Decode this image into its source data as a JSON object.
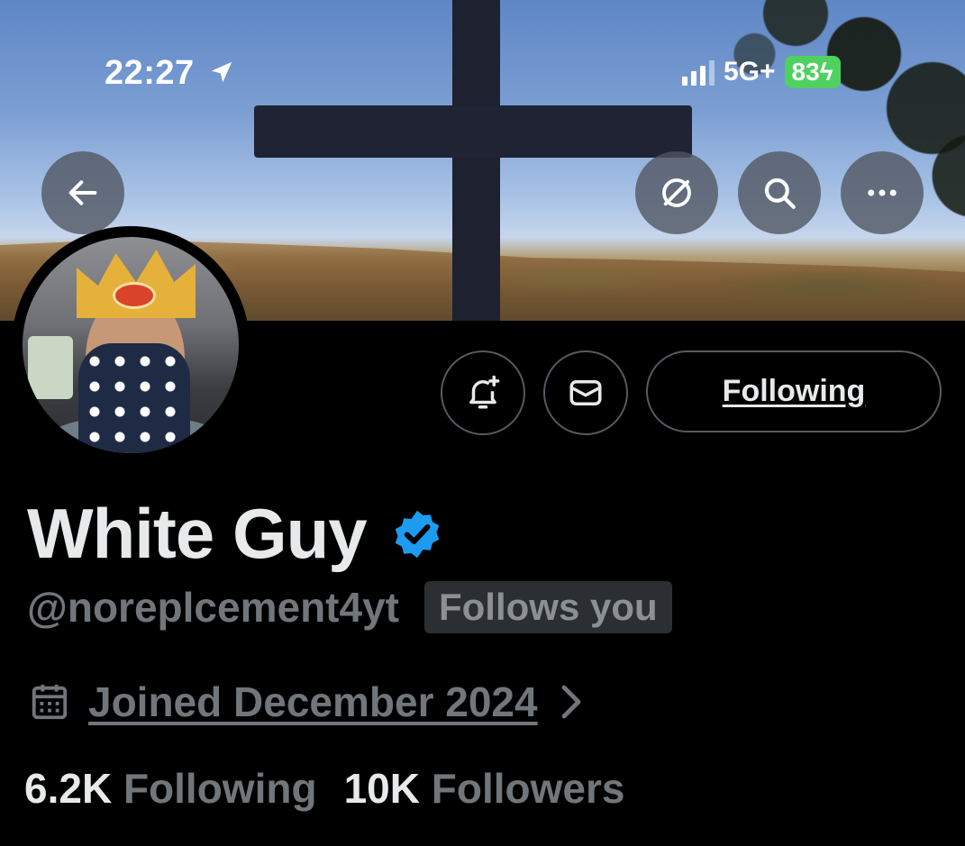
{
  "status_bar": {
    "time": "22:27",
    "network": "5G+",
    "battery": "83"
  },
  "banner_buttons": {
    "back_icon": "arrow-left-icon",
    "grok_icon": "slash-circle-icon",
    "search_icon": "search-icon",
    "more_icon": "more-horizontal-icon"
  },
  "actions": {
    "notify_icon": "bell-plus-icon",
    "message_icon": "envelope-icon",
    "follow_label": "Following"
  },
  "profile": {
    "display_name": "White Guy",
    "handle": "@noreplcement4yt",
    "follows_you": "Follows you",
    "joined": "Joined December 2024",
    "verified_color": "#1d9bf0"
  },
  "stats": {
    "following_count": "6.2K",
    "following_label": "Following",
    "followers_count": "10K",
    "followers_label": "Followers"
  }
}
